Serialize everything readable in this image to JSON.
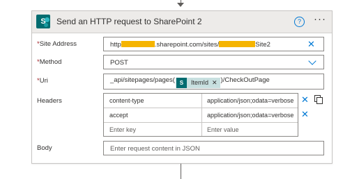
{
  "card": {
    "title": "Send an HTTP request to SharePoint 2",
    "help_symbol": "?",
    "more_symbol": "···",
    "logo_letter": "S"
  },
  "fields": {
    "site_address": {
      "label": "Site Address",
      "value_prefix": "http",
      "value_middle": ".sharepoint.com/sites/",
      "value_suffix": "Site2"
    },
    "method": {
      "label": "Method",
      "value": "POST"
    },
    "uri": {
      "label": "Uri",
      "value_prefix": "_api/sitepages/pages(",
      "token_label": "ItemId",
      "value_suffix": ")/CheckOutPage"
    },
    "headers": {
      "label": "Headers",
      "rows": [
        {
          "key": "content-type",
          "value": "application/json;odata=verbose"
        },
        {
          "key": "accept",
          "value": "application/json;odata=verbose"
        }
      ],
      "key_placeholder": "Enter key",
      "value_placeholder": "Enter value"
    },
    "body": {
      "label": "Body",
      "placeholder": "Enter request content in JSON"
    }
  },
  "required_marker": "*",
  "icons": {
    "clear": "close-icon",
    "dropdown": "chevron-down-icon",
    "token_remove": "close-icon",
    "switch_mode": "text-mode-icon",
    "logo": "sharepoint-icon"
  },
  "colors": {
    "accent": "#0078d4",
    "sharepoint": "#036c70",
    "redaction": "#f5b400",
    "token_bg": "#c8e0e0",
    "required": "#a4262c"
  }
}
